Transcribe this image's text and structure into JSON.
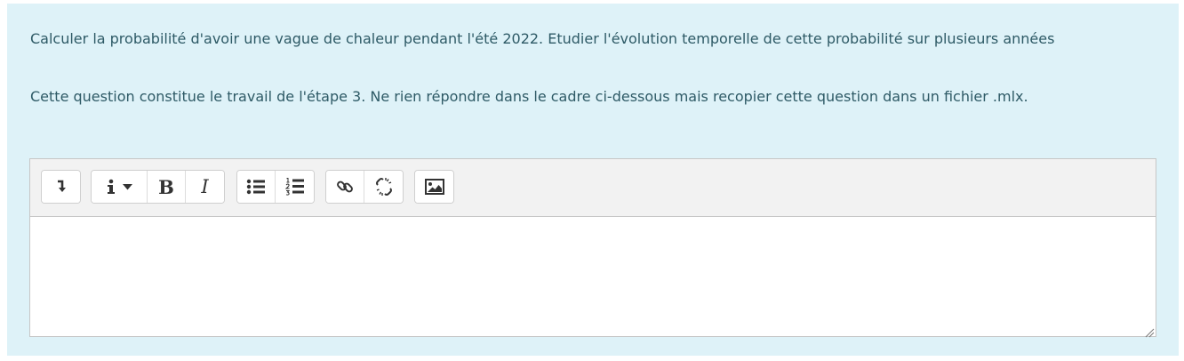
{
  "question": {
    "line1": "Calculer la probabilité d'avoir une vague de chaleur pendant l'été 2022. Etudier l'évolution temporelle de cette probabilité sur plusieurs années",
    "line2": "Cette question constitue le travail de l'étape 3. Ne rien répondre dans le cadre ci-dessous mais recopier cette question dans un fichier .mlx."
  },
  "toolbar": {
    "bold_label": "B",
    "italic_label": "I",
    "icons": [
      "toolbar-toggle-icon",
      "info-icon",
      "chevron-down-icon",
      "bullet-list-icon",
      "numbered-list-icon",
      "link-icon",
      "unlink-icon",
      "image-icon"
    ]
  },
  "editor": {
    "content": ""
  },
  "colors": {
    "panel_background": "#def2f8",
    "text": "#2e5a66",
    "toolbar_background": "#f2f2f2"
  }
}
